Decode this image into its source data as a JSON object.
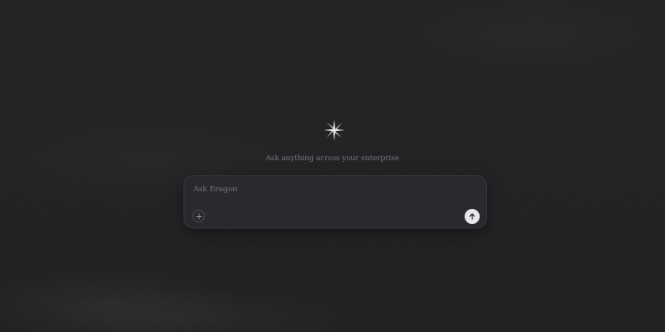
{
  "hero": {
    "tagline": "Ask anything across your enterprise"
  },
  "composer": {
    "placeholder": "Ask Eragon",
    "value": "",
    "attach_icon": "plus-icon",
    "send_icon": "arrow-up-icon"
  },
  "colors": {
    "background": "#1c1c1e",
    "composer_background": "#2a292d",
    "send_button": "#e8e8ea"
  }
}
